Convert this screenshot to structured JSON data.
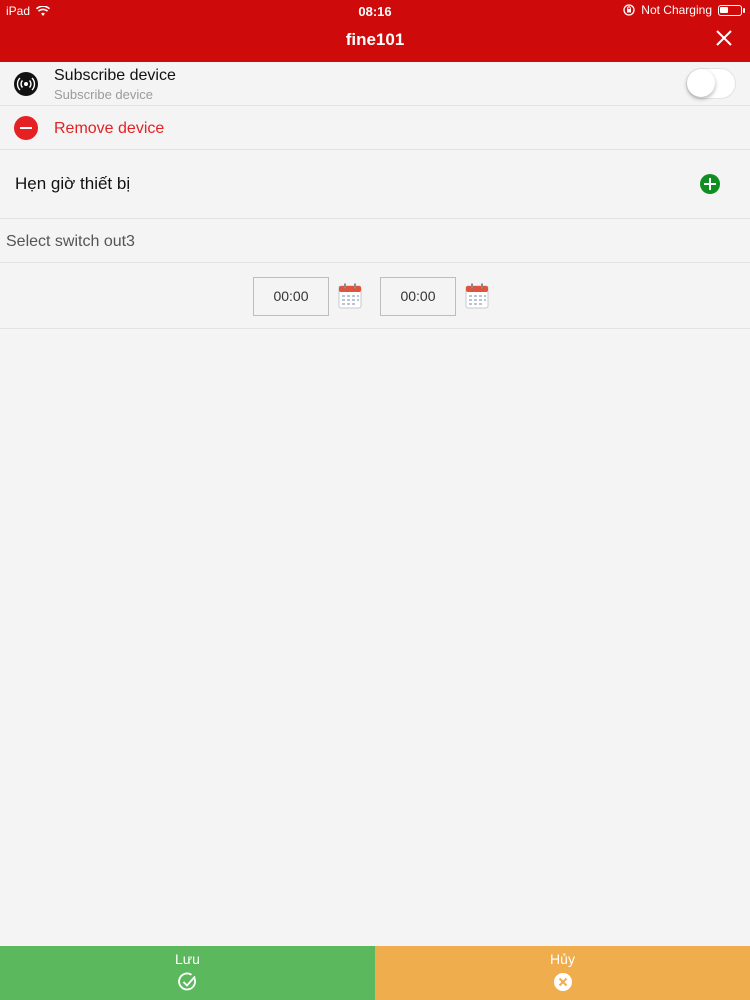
{
  "status_bar": {
    "device": "iPad",
    "time": "08:16",
    "charging": "Not Charging"
  },
  "header": {
    "title": "fine101"
  },
  "subscribe": {
    "label": "Subscribe device",
    "sublabel": "Subscribe device",
    "toggle_on": false
  },
  "remove": {
    "label": "Remove device"
  },
  "schedule": {
    "label": "Hẹn giờ thiết bị"
  },
  "select": {
    "label": "Select switch out3"
  },
  "time_range": {
    "start": "00:00",
    "end": "00:00"
  },
  "footer": {
    "save_label": "Lưu",
    "cancel_label": "Hủy"
  },
  "colors": {
    "header": "#cf0a0a",
    "remove": "#e52124",
    "add": "#0f8f22",
    "save": "#5cb85c",
    "cancel": "#f0ad4e"
  }
}
